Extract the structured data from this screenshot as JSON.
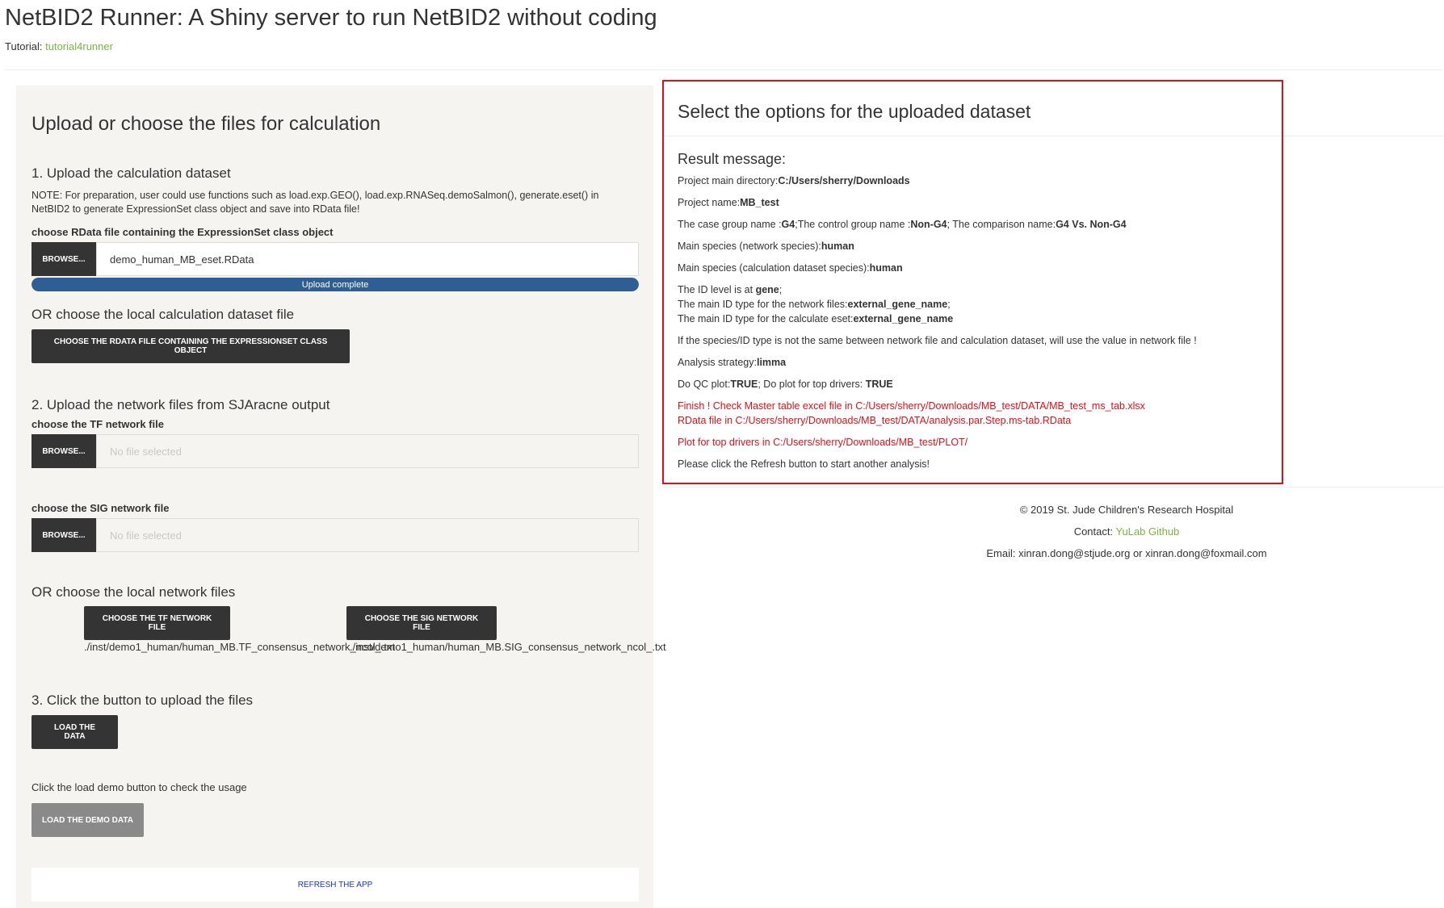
{
  "header": {
    "title": "NetBID2 Runner: A Shiny server to run NetBID2 without coding",
    "tutorial_prefix": "Tutorial:",
    "tutorial_link": "tutorial4runner"
  },
  "left": {
    "panel_title": "Upload or choose the files for calculation",
    "sec1_title": "1. Upload the calculation dataset",
    "note_line1": "NOTE: For preparation, user could use functions such as load.exp.GEO(), load.exp.RNASeq.demoSalmon(), generate.eset() in",
    "note_line2": "NetBID2 to generate ExpressionSet class object and save into RData file!",
    "rdata_label": "choose RData file containing the ExpressionSet class object",
    "browse_label": "BROWSE...",
    "rdata_file": "demo_human_MB_eset.RData",
    "upload_status": "Upload complete",
    "upload_progress": 1.0,
    "or_local_dataset": "OR choose the local calculation dataset file",
    "choose_rdata_button": "CHOOSE THE RDATA FILE CONTAINING THE EXPRESSIONSET CLASS OBJECT",
    "sec2_title": "2. Upload the network files from SJAracne output",
    "tf_label": "choose the TF network file",
    "tf_placeholder": "No file selected",
    "sig_label": "choose the SIG network file",
    "sig_placeholder": "No file selected",
    "or_local_network": "OR choose the local network files",
    "choose_tf_button": "CHOOSE THE TF NETWORK FILE",
    "choose_sig_button": "CHOOSE THE SIG NETWORK FILE",
    "tf_path": "./inst/demo1_human/human_MB.TF_consensus_network_ncol_.txt",
    "sig_path": "./inst/demo1_human/human_MB.SIG_consensus_network_ncol_.txt",
    "sec3_title": "3. Click the button to upload the files",
    "load_data_button": "LOAD THE DATA",
    "demo_hint": "Click the load demo button to check the usage",
    "load_demo_button": "LOAD THE DEMO DATA",
    "refresh_button": "REFRESH THE APP"
  },
  "result": {
    "title": "Select the options for the uploaded dataset",
    "subtitle": "Result message:",
    "dir_label": "Project main directory:",
    "dir_value": "C:/Users/sherry/Downloads",
    "name_label": "Project name:",
    "name_value": "MB_test",
    "case_label": "The case group name :",
    "case_value": "G4",
    "control_label": ";The control group name :",
    "control_value": "Non-G4",
    "comp_label": "; The comparison name:",
    "comp_value": "G4 Vs. Non-G4",
    "net_species_label": "Main species (network species):",
    "net_species_value": "human",
    "calc_species_label": "Main species (calculation dataset species):",
    "calc_species_value": "human",
    "id_level_label": "The ID level is at ",
    "id_level_value": "gene",
    "id_level_end": ";",
    "net_id_label": "The main ID type for the network files:",
    "net_id_value": "external_gene_name",
    "net_id_end": ";",
    "eset_id_label": "The main ID type for the calculate eset:",
    "eset_id_value": "external_gene_name",
    "warning": "If the species/ID type is not the same between network file and calculation dataset, will use the value in network file !",
    "strategy_label": "Analysis strategy:",
    "strategy_value": "limma",
    "qc_label": "Do QC plot:",
    "qc_value": "TRUE",
    "top_label": "; Do plot for top drivers: ",
    "top_value": "TRUE",
    "finish_line1": "Finish ! Check Master table excel file in C:/Users/sherry/Downloads/MB_test/DATA/MB_test_ms_tab.xlsx",
    "finish_line2": "RData file in C:/Users/sherry/Downloads/MB_test/DATA/analysis.par.Step.ms-tab.RData",
    "plot_line": "Plot for top drivers in C:/Users/sherry/Downloads/MB_test/PLOT/",
    "refresh_hint": "Please click the Refresh button to start another analysis!"
  },
  "footer": {
    "copyright": "© 2019 St. Jude Children's Research Hospital",
    "contact_prefix": "Contact:",
    "contact_link": "YuLab Github",
    "email": "Email: xinran.dong@stjude.org or xinran.dong@foxmail.com"
  },
  "colors": {
    "accent_green": "#7cb342",
    "progress_blue": "#2f5e94",
    "error_red": "#e0101a",
    "dark_button": "#343434"
  }
}
